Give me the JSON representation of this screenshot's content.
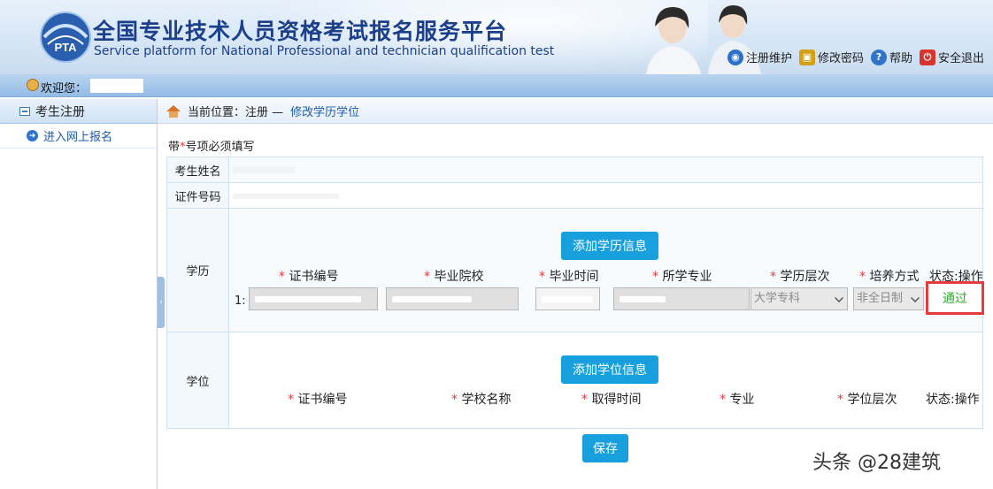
{
  "header": {
    "title_cn": "全国专业技术人员资格考试报名服务平台",
    "title_en": "Service platform for National Professional and technician qualification test",
    "logo_text": "PTA",
    "toolbar": [
      {
        "label": "注册维护",
        "icon": "globe-icon",
        "color": "#2a6fc9"
      },
      {
        "label": "修改密码",
        "icon": "lock-icon",
        "color": "#d4a017"
      },
      {
        "label": "帮助",
        "icon": "help-icon",
        "color": "#2f74c8"
      },
      {
        "label": "安全退出",
        "icon": "power-icon",
        "color": "#d9342b"
      }
    ]
  },
  "welcome": {
    "label": "欢迎您："
  },
  "sidebar": {
    "section": "考生注册",
    "items": [
      {
        "label": "进入网上报名"
      }
    ]
  },
  "breadcrumb": {
    "prefix": "当前位置：注册 —",
    "current": "修改学历学位"
  },
  "form": {
    "required_note_pre": "带",
    "required_star": "*",
    "required_note_post": "号项必须填写",
    "name_label": "考生姓名",
    "id_label": "证件号码",
    "education": {
      "label": "学历",
      "add_button": "添加学历信息",
      "columns": [
        "证书编号",
        "毕业院校",
        "毕业时间",
        "所学专业",
        "学历层次",
        "培养方式",
        "状态:操作"
      ],
      "row_index": "1:",
      "degree_level": "大学专科",
      "study_mode": "非全日制",
      "status": "通过"
    },
    "degree": {
      "label": "学位",
      "add_button": "添加学位信息",
      "columns": [
        "证书编号",
        "学校名称",
        "取得时间",
        "专业",
        "学位层次",
        "状态:操作"
      ]
    },
    "save_button": "保存"
  },
  "watermark": "头条 @28建筑",
  "colors": {
    "accent": "#17a0dd",
    "status_ok": "#2faa2f",
    "highlight": "#e83c3c"
  }
}
